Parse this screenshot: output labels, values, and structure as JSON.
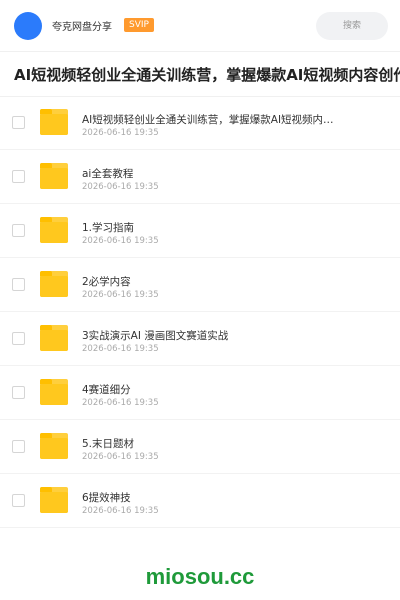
{
  "header": {
    "brand": "夸克网盘分享",
    "badge": "SVIP",
    "search_label": "搜索"
  },
  "share_title": "AI短视频轻创业全通关训练营，掌握爆款AI短视频内容创作",
  "files": [
    {
      "name": "AI短视频轻创业全通关训练营，掌握爆款AI短视频内…",
      "date": "2026-06-16 19:35"
    },
    {
      "name": "ai全套教程",
      "date": "2026-06-16 19:35"
    },
    {
      "name": "1.学习指南",
      "date": "2026-06-16 19:35"
    },
    {
      "name": "2必学内容",
      "date": "2026-06-16 19:35"
    },
    {
      "name": "3实战演示AI 漫画图文赛道实战",
      "date": "2026-06-16 19:35"
    },
    {
      "name": "4赛道细分",
      "date": "2026-06-16 19:35"
    },
    {
      "name": "5.末日题材",
      "date": "2026-06-16 19:35"
    },
    {
      "name": "6提效神技",
      "date": "2026-06-16 19:35"
    }
  ],
  "watermark": "miosou.cc",
  "colors": {
    "avatar": "#2b7bfb",
    "badge": "#ff9a2e",
    "folder": "#ffc81e",
    "watermark": "#1f9a3a"
  },
  "icons": {
    "folder": "folder-icon",
    "checkbox": "checkbox"
  }
}
